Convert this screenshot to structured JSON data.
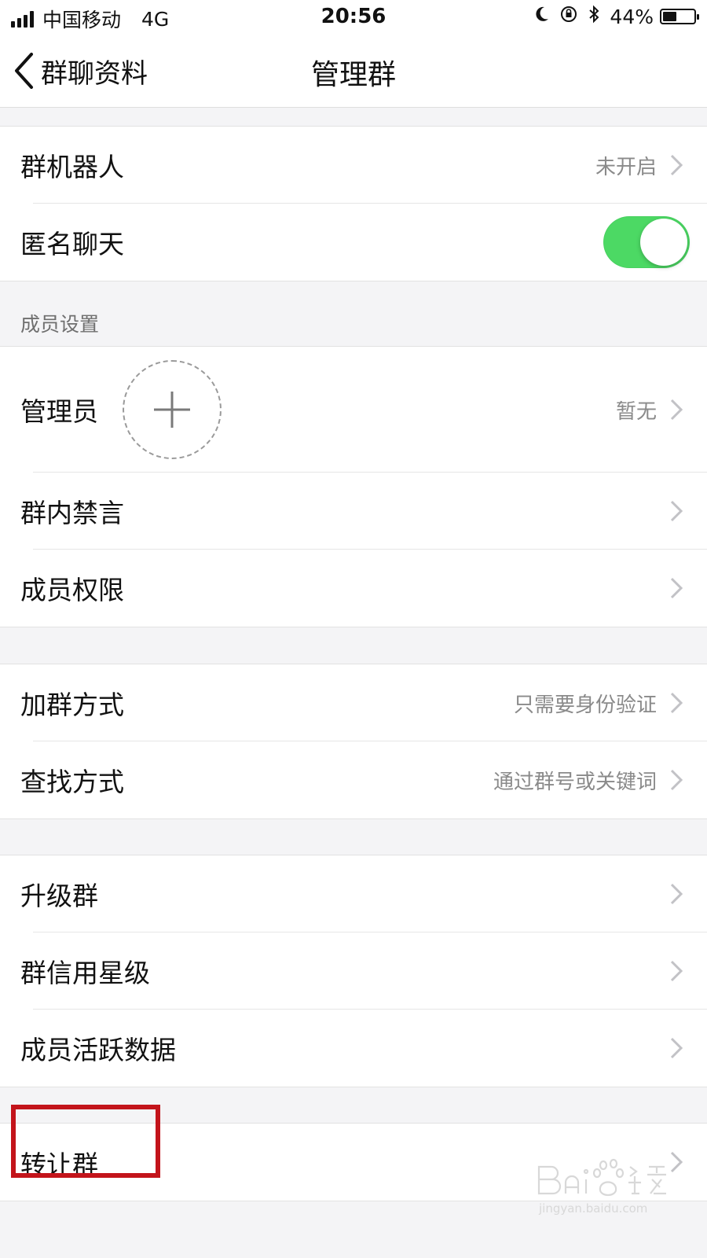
{
  "status_bar": {
    "carrier": "中国移动",
    "network": "4G",
    "time": "20:56",
    "battery": "44%",
    "battery_level": 0.44,
    "icons": [
      "signal-icon",
      "moon-icon",
      "orientation-lock-icon",
      "bluetooth-icon",
      "battery-icon"
    ]
  },
  "nav": {
    "back_label": "群聊资料",
    "title": "管理群"
  },
  "group1": {
    "robot": {
      "label": "群机器人",
      "value": "未开启"
    },
    "anonymous": {
      "label": "匿名聊天",
      "toggle_on": true
    }
  },
  "members_section": {
    "header": "成员设置",
    "admin": {
      "label": "管理员",
      "value": "暂无"
    },
    "mute": {
      "label": "群内禁言"
    },
    "permissions": {
      "label": "成员权限"
    }
  },
  "join_group": {
    "join_method": {
      "label": "加群方式",
      "value": "只需要身份验证"
    },
    "find_method": {
      "label": "查找方式",
      "value": "通过群号或关键词"
    }
  },
  "more_group": {
    "upgrade": {
      "label": "升级群"
    },
    "credit": {
      "label": "群信用星级"
    },
    "activity": {
      "label": "成员活跃数据"
    }
  },
  "transfer_group": {
    "transfer": {
      "label": "转让群"
    }
  },
  "colors": {
    "toggle_on": "#4cd964",
    "highlight": "#c3141b",
    "background": "#f4f4f6"
  }
}
